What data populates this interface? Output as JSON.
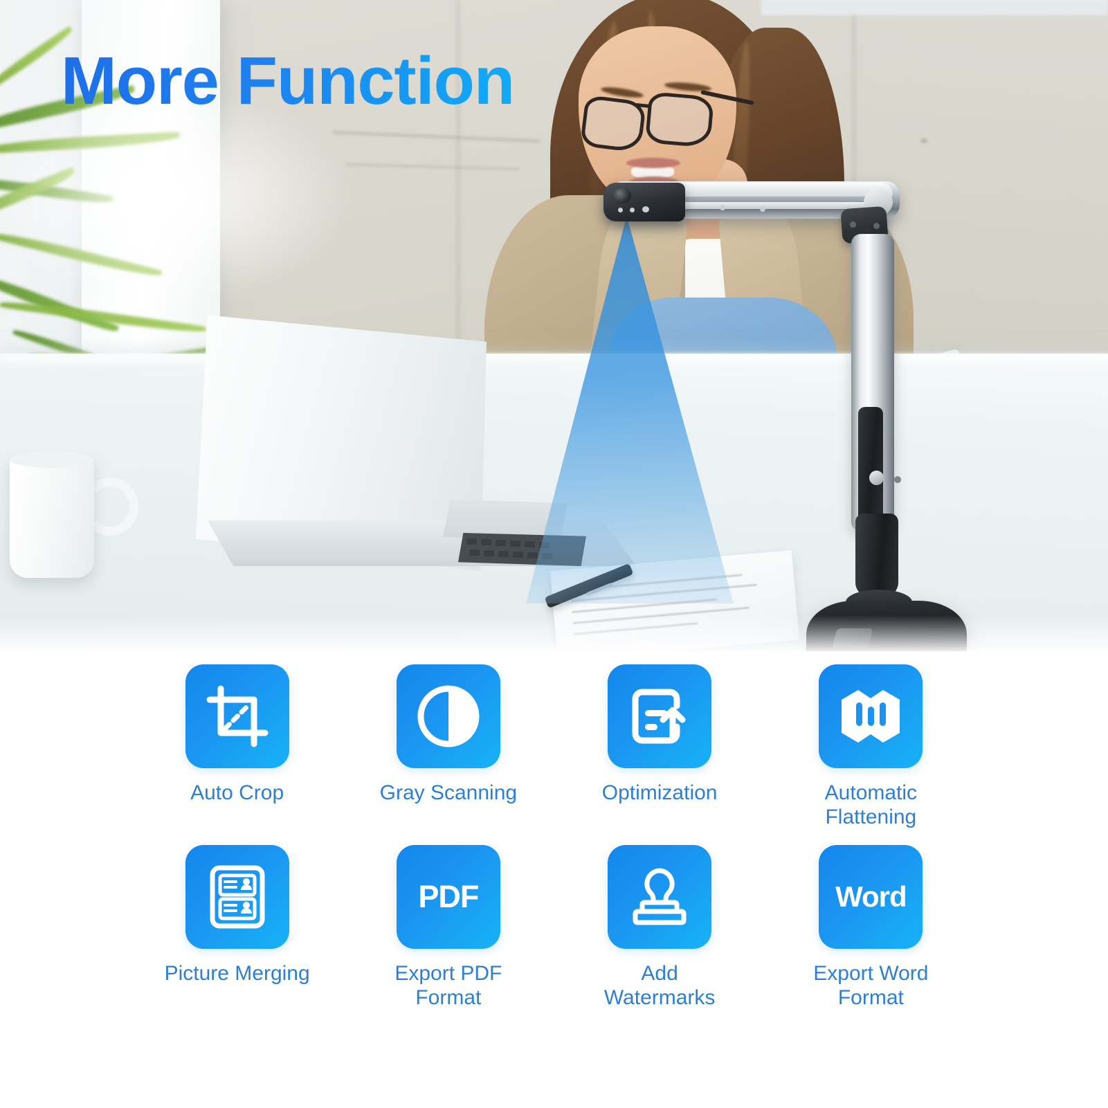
{
  "headline": "More Function",
  "colors": {
    "headline_gradient_start": "#1f6fe8",
    "headline_gradient_end": "#12aaf5",
    "tile_gradient_start": "#1387ec",
    "tile_gradient_end": "#17b2f7",
    "label_blue": "#2b7fd4",
    "scan_cone_blue": "#3a96e1",
    "page_background": "#ffffff"
  },
  "photo": {
    "description": "Woman with glasses at a white office desk using a document camera scanner next to a silver laptop",
    "scene_items": [
      "potted-palm-plant",
      "white-coffee-mug",
      "silver-laptop",
      "paper-document",
      "black-pen",
      "white-tablet",
      "document-scanner"
    ]
  },
  "features": [
    {
      "icon": "crop-icon",
      "label": "Auto Crop",
      "label_lines": [
        "Auto Crop"
      ]
    },
    {
      "icon": "contrast-circle-icon",
      "label": "Gray Scanning",
      "label_lines": [
        "Gray Scanning"
      ]
    },
    {
      "icon": "document-upload-icon",
      "label": "Optimization",
      "label_lines": [
        "Optimization"
      ]
    },
    {
      "icon": "folded-map-icon",
      "label": "Automatic Flattening",
      "label_lines": [
        "Automatic",
        "Flattening"
      ]
    },
    {
      "icon": "id-card-list-icon",
      "label": "Picture Merging",
      "label_lines": [
        "Picture Merging"
      ]
    },
    {
      "icon": "pdf-wordmark-icon",
      "label": "Export PDF Format",
      "label_lines": [
        "Export PDF",
        "Format"
      ],
      "wordmark": "PDF"
    },
    {
      "icon": "stamp-icon",
      "label": "Add Watermarks",
      "label_lines": [
        "Add",
        "Watermarks"
      ]
    },
    {
      "icon": "word-wordmark-icon",
      "label": "Export Word Format",
      "label_lines": [
        "Export Word",
        "Format"
      ],
      "wordmark": "Word"
    }
  ]
}
